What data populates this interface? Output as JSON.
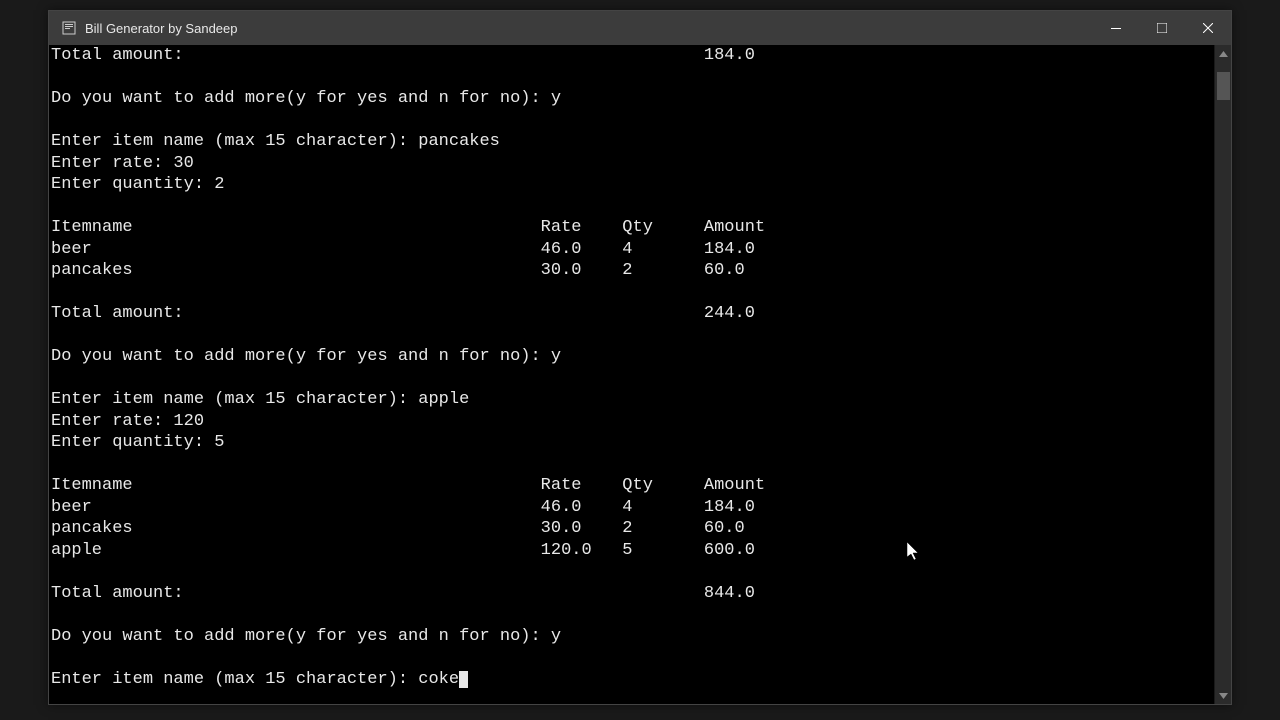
{
  "window": {
    "title": "Bill Generator by Sandeep"
  },
  "prompts": {
    "total_label": "Total amount:",
    "add_more": "Do you want to add more(y for yes and n for no): ",
    "enter_item": "Enter item name (max 15 character): ",
    "enter_rate": "Enter rate: ",
    "enter_qty": "Enter quantity: "
  },
  "headers": {
    "itemname": "Itemname",
    "rate": "Rate",
    "qty": "Qty",
    "amount": "Amount"
  },
  "block1": {
    "total": "184.0",
    "answer": "y",
    "item": "pancakes",
    "rate": "30",
    "qty": "2"
  },
  "table1": {
    "rows": [
      {
        "name": "beer",
        "rate": "46.0",
        "qty": "4",
        "amount": "184.0"
      },
      {
        "name": "pancakes",
        "rate": "30.0",
        "qty": "2",
        "amount": "60.0"
      }
    ],
    "total": "244.0"
  },
  "block2": {
    "answer": "y",
    "item": "apple",
    "rate": "120",
    "qty": "5"
  },
  "table2": {
    "rows": [
      {
        "name": "beer",
        "rate": "46.0",
        "qty": "4",
        "amount": "184.0"
      },
      {
        "name": "pancakes",
        "rate": "30.0",
        "qty": "2",
        "amount": "60.0"
      },
      {
        "name": "apple",
        "rate": "120.0",
        "qty": "5",
        "amount": "600.0"
      }
    ],
    "total": "844.0"
  },
  "block3": {
    "answer": "y",
    "item": "coke"
  },
  "cols": {
    "name_w": 48,
    "rate_w": 8,
    "qty_w": 8
  }
}
